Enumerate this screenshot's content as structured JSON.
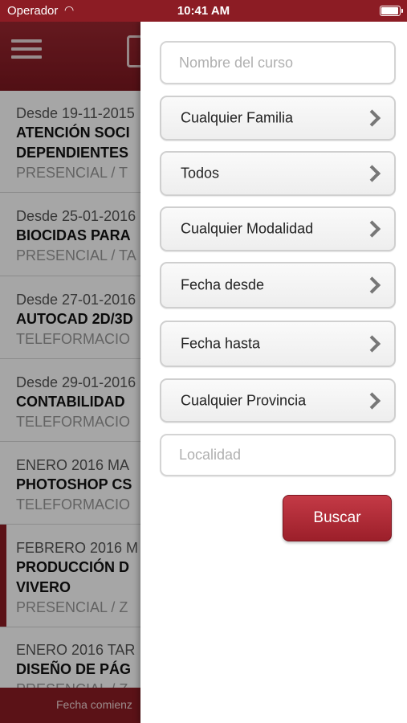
{
  "status_bar": {
    "carrier": "Operador",
    "time": "10:41 AM"
  },
  "list": {
    "items": [
      {
        "date": "Desde 19-11-2015",
        "title": "ATENCIÓN SOCI",
        "title2": "DEPENDIENTES",
        "mode": "PRESENCIAL / T"
      },
      {
        "date": "Desde 25-01-2016",
        "title": "BIOCIDAS PARA",
        "mode": "PRESENCIAL / TA"
      },
      {
        "date": "Desde 27-01-2016",
        "title": "AUTOCAD 2D/3D",
        "mode": "TELEFORMACIO"
      },
      {
        "date": "Desde 29-01-2016",
        "title": "CONTABILIDAD",
        "mode": "TELEFORMACIO"
      },
      {
        "date": "ENERO 2016 MA",
        "title": "PHOTOSHOP CS",
        "mode": "TELEFORMACIO"
      },
      {
        "date": "FEBRERO 2016 M",
        "title": "PRODUCCIÓN D",
        "title2": "VIVERO",
        "mode": "PRESENCIAL / Z"
      },
      {
        "date": "ENERO 2016 TAR",
        "title": "DISEÑO DE PÁG",
        "mode": "PRESENCIAL / Z"
      }
    ]
  },
  "bottom_bar": {
    "label": "Fecha comienz"
  },
  "filters": {
    "course_name_placeholder": "Nombre del curso",
    "family": "Cualquier Familia",
    "all": "Todos",
    "modality": "Cualquier Modalidad",
    "date_from": "Fecha desde",
    "date_to": "Fecha hasta",
    "province": "Cualquier Provincia",
    "locality_placeholder": "Localidad",
    "search_button": "Buscar"
  },
  "colors": {
    "brand": "#8c1c24",
    "button": "#b12f3a"
  }
}
